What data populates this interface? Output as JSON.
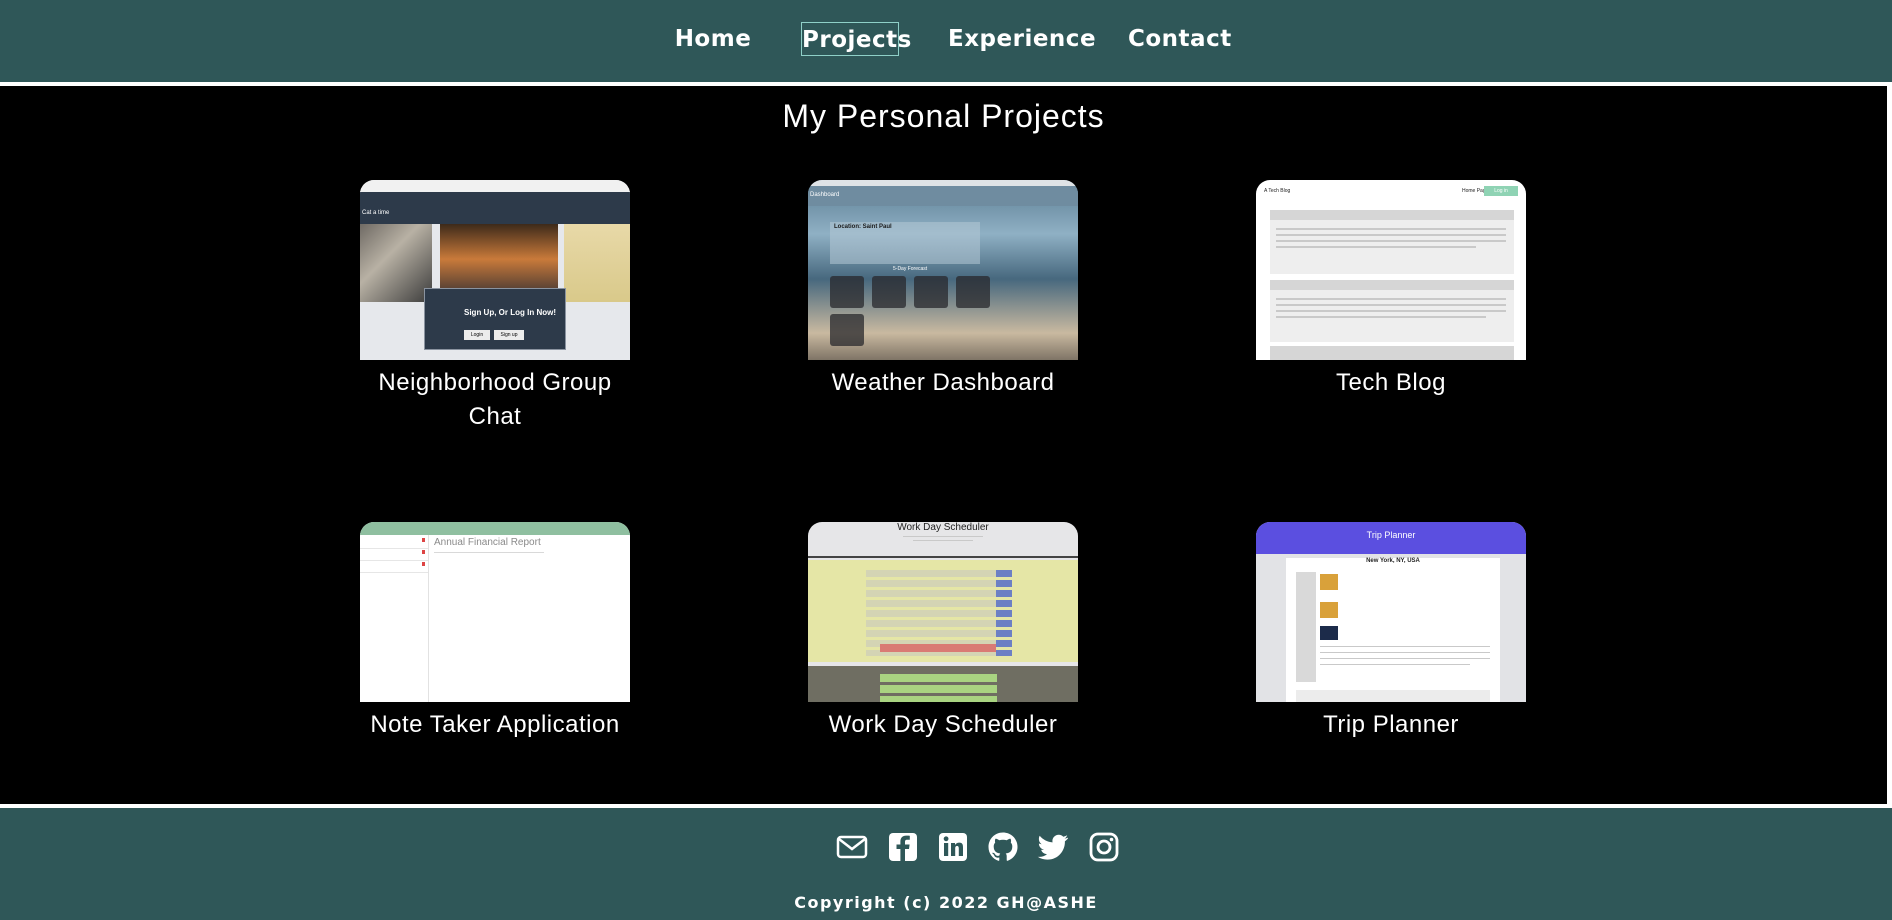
{
  "nav": {
    "items": [
      {
        "label": "Home"
      },
      {
        "label": "Projects"
      },
      {
        "label": "Experience"
      },
      {
        "label": "Contact"
      }
    ]
  },
  "main": {
    "title": "My Personal Projects",
    "projects": [
      {
        "label": "Neighborhood Group Chat",
        "thumb": {
          "heading": "Sign Up, Or Log In Now!",
          "btn1": "Login",
          "btn2": "Sign up",
          "caption": "Cat a time"
        }
      },
      {
        "label": "Weather Dashboard",
        "thumb": {
          "heading": "Location: Saint Paul",
          "subheading": "5-Day Forecast",
          "caption": "Dashboard"
        }
      },
      {
        "label": "Tech Blog",
        "thumb": {
          "brand": "A Tech Blog",
          "link": "Home Page",
          "btn": "Log in"
        }
      },
      {
        "label": "Note Taker Application",
        "thumb": {
          "heading": "Annual Financial Report"
        }
      },
      {
        "label": "Work Day Scheduler",
        "thumb": {
          "heading": "Work Day Scheduler"
        }
      },
      {
        "label": "Trip Planner",
        "thumb": {
          "heading": "Trip Planner",
          "location": "New York, NY, USA"
        }
      }
    ]
  },
  "footer": {
    "icons": [
      "mail-icon",
      "facebook-icon",
      "linkedin-icon",
      "github-icon",
      "twitter-icon",
      "instagram-icon"
    ],
    "copyright": "Copyright (c) 2022 GH@ASHE"
  },
  "colors": {
    "header_bg": "#2f5758",
    "main_bg": "#000000",
    "divider": "#ffffff",
    "active_border": "#8fd0c8"
  }
}
